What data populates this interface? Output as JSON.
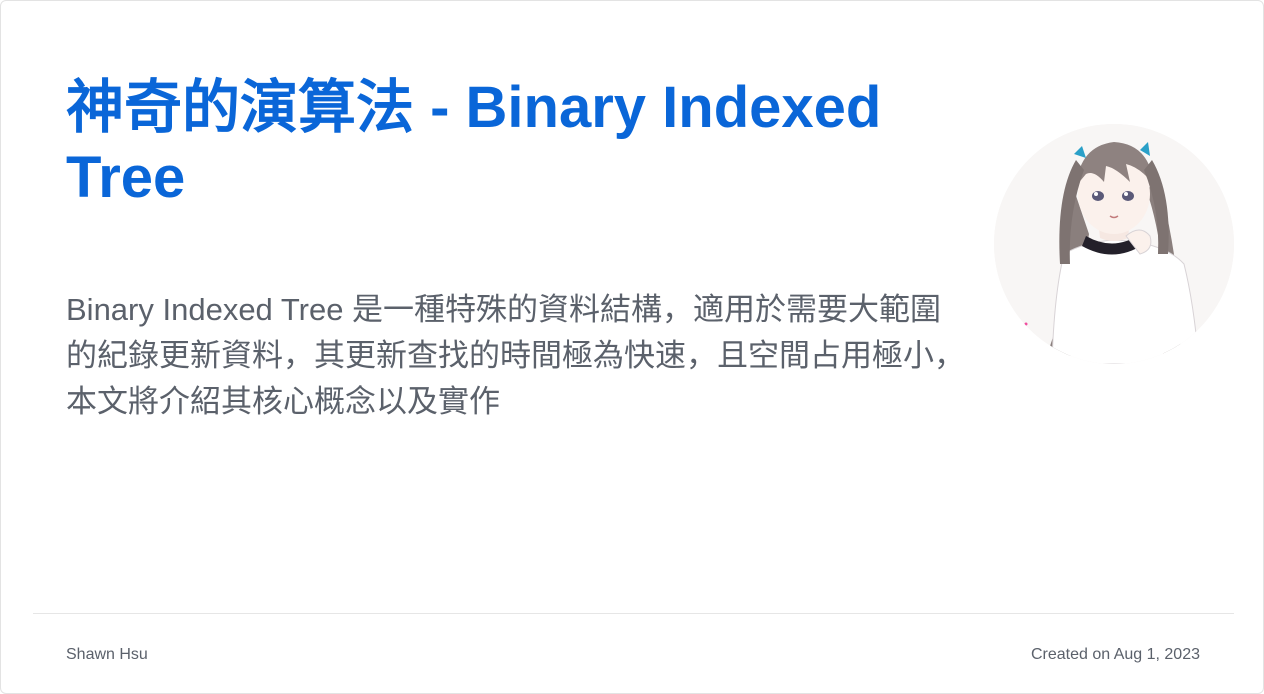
{
  "post": {
    "title": "神奇的演算法 - Binary Indexed Tree",
    "description": "Binary Indexed Tree 是一種特殊的資料結構，適用於需要大範圍的紀錄更新資料，其更新查找的時間極為快速，且空間占用極小，本文將介紹其核心概念以及實作",
    "author": "Shawn Hsu",
    "created": "Created on Aug 1, 2023"
  },
  "avatar": {
    "icon": "anime-girl-avatar-illustration"
  },
  "colors": {
    "title": "#0a66d8",
    "text": "#5b616b",
    "divider": "#e6e6e6",
    "background": "#ffffff"
  }
}
